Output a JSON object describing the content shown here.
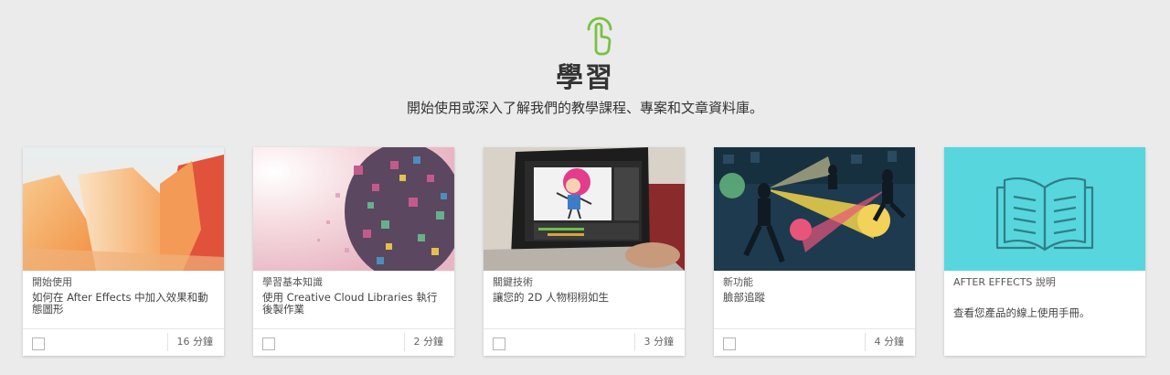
{
  "header": {
    "icon": "tap-hand-icon",
    "accent_color": "#7ac143",
    "title": "學習",
    "subtitle": "開始使用或深入了解我們的教學課程、專案和文章資料庫。"
  },
  "cards": [
    {
      "thumb": "orange-cliffs-image",
      "kicker": "開始使用",
      "title": "如何在 After Effects 中加入效果和動態圖形",
      "duration": "16 分鐘"
    },
    {
      "thumb": "pixel-swirl-image",
      "kicker": "學習基本知識",
      "title": "使用 Creative Cloud Libraries 執行後製作業",
      "duration": "2 分鐘"
    },
    {
      "thumb": "laptop-animation-image",
      "kicker": "關鍵技術",
      "title": "讓您的 2D 人物栩栩如生",
      "duration": "3 分鐘"
    },
    {
      "thumb": "face-tracking-illustration",
      "kicker": "新功能",
      "title": "臉部追蹤",
      "duration": "4 分鐘"
    }
  ],
  "help_card": {
    "thumb": "open-book-icon",
    "thumb_color": "#57d6de",
    "kicker": "AFTER EFFECTS 說明",
    "description": "查看您產品的線上使用手冊。"
  }
}
